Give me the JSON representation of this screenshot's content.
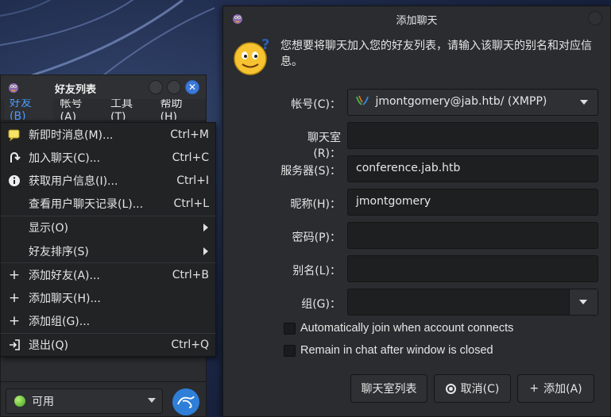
{
  "buddy_list": {
    "title": "好友列表",
    "menu": [
      "好友(B)",
      "帐号(A)",
      "工具(T)",
      "帮助(H)"
    ],
    "status": "可用"
  },
  "buddies_menu": {
    "items": [
      {
        "label": "新即时消息(M)...",
        "shortcut": "Ctrl+M",
        "icon": "new-message-icon"
      },
      {
        "label": "加入聊天(C)...",
        "shortcut": "Ctrl+C",
        "icon": "join-chat-icon"
      },
      {
        "label": "获取用户信息(I)...",
        "shortcut": "Ctrl+I",
        "icon": "info-icon"
      },
      {
        "label": "查看用户聊天记录(L)...",
        "shortcut": "Ctrl+L",
        "icon": ""
      },
      {
        "label": "显示(O)",
        "shortcut": "",
        "icon": "",
        "submenu": true
      },
      {
        "label": "好友排序(S)",
        "shortcut": "",
        "icon": "",
        "submenu": true
      },
      {
        "label": "添加好友(A)...",
        "shortcut": "Ctrl+B",
        "icon": "plus-icon"
      },
      {
        "label": "添加聊天(H)...",
        "shortcut": "",
        "icon": "plus-icon"
      },
      {
        "label": "添加组(G)...",
        "shortcut": "",
        "icon": "plus-icon"
      },
      {
        "label": "退出(Q)",
        "shortcut": "Ctrl+Q",
        "icon": "exit-icon"
      }
    ]
  },
  "add_chat_dialog": {
    "title": "添加聊天",
    "intro": "您想要将聊天加入您的好友列表，请输入该聊天的别名和对应信息。",
    "fields": {
      "account_label": "帐号(C)：",
      "account_value": "jmontgomery@jab.htb/ (XMPP)",
      "room_label": "聊天室(R)：",
      "room_value": "",
      "server_label": "服务器(S)：",
      "server_value": "conference.jab.htb",
      "handle_label": "昵称(H)：",
      "handle_value": "jmontgomery",
      "password_label": "密码(P)：",
      "password_value": "",
      "alias_label": "别名(L)：",
      "alias_value": "",
      "group_label": "组(G)：",
      "group_value": ""
    },
    "checkboxes": {
      "autojoin": "Automatically join when account connects",
      "persistent": "Remain in chat after window is closed"
    },
    "buttons": {
      "room_list": "聊天室列表",
      "cancel": "取消(C)",
      "add": "添加(A)"
    }
  },
  "colors": {
    "accent": "#3c78d8",
    "status_available": "#3fa11a"
  }
}
